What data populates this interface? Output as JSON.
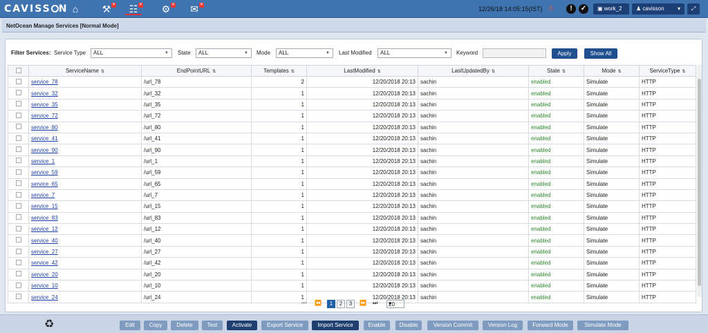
{
  "app": {
    "logo": "CAVISSON",
    "datetime": "12/26/18 14:05:15(IST)",
    "workspace": "work_2",
    "user": "cavisson"
  },
  "page_title": "NetOcean Manage Services [Normal Mode]",
  "filters": {
    "label": "Filter Services:",
    "service_type_label": "Service Type",
    "service_type_value": "ALL",
    "state_label": "State",
    "state_value": "ALL",
    "mode_label": "Mode",
    "mode_value": "ALL",
    "last_modified_label": "Last Modified",
    "last_modified_value": "ALL",
    "keyword_label": "Keyword",
    "keyword_value": "",
    "apply": "Apply",
    "show_all": "Show All"
  },
  "columns": [
    "ServiceName",
    "EndPointURL",
    "Templates",
    "LastModified",
    "LastUpdatedBy",
    "State",
    "Mode",
    "ServiceType"
  ],
  "rows": [
    [
      "service_78",
      "/url_78",
      "2",
      "12/20/2018 20:13",
      "sachin",
      "enabled",
      "Simulate",
      "HTTP"
    ],
    [
      "service_32",
      "/url_32",
      "1",
      "12/20/2018 20:13",
      "sachin",
      "enabled",
      "Simulate",
      "HTTP"
    ],
    [
      "service_35",
      "/url_35",
      "1",
      "12/20/2018 20:13",
      "sachin",
      "enabled",
      "Simulate",
      "HTTP"
    ],
    [
      "service_72",
      "/url_72",
      "1",
      "12/20/2018 20:13",
      "sachin",
      "enabled",
      "Simulate",
      "HTTP"
    ],
    [
      "service_80",
      "/url_80",
      "1",
      "12/20/2018 20:13",
      "sachin",
      "enabled",
      "Simulate",
      "HTTP"
    ],
    [
      "service_41",
      "/url_41",
      "1",
      "12/20/2018 20:13",
      "sachin",
      "enabled",
      "Simulate",
      "HTTP"
    ],
    [
      "service_90",
      "/url_90",
      "1",
      "12/20/2018 20:13",
      "sachin",
      "enabled",
      "Simulate",
      "HTTP"
    ],
    [
      "service_1",
      "/url_1",
      "1",
      "12/20/2018 20:13",
      "sachin",
      "enabled",
      "Simulate",
      "HTTP"
    ],
    [
      "service_59",
      "/url_59",
      "1",
      "12/20/2018 20:13",
      "sachin",
      "enabled",
      "Simulate",
      "HTTP"
    ],
    [
      "service_65",
      "/url_65",
      "1",
      "12/20/2018 20:13",
      "sachin",
      "enabled",
      "Simulate",
      "HTTP"
    ],
    [
      "service_7",
      "/url_7",
      "1",
      "12/20/2018 20:13",
      "sachin",
      "enabled",
      "Simulate",
      "HTTP"
    ],
    [
      "service_15",
      "/url_15",
      "1",
      "12/20/2018 20:13",
      "sachin",
      "enabled",
      "Simulate",
      "HTTP"
    ],
    [
      "service_83",
      "/url_83",
      "1",
      "12/20/2018 20:13",
      "sachin",
      "enabled",
      "Simulate",
      "HTTP"
    ],
    [
      "service_12",
      "/url_12",
      "1",
      "12/20/2018 20:13",
      "sachin",
      "enabled",
      "Simulate",
      "HTTP"
    ],
    [
      "service_40",
      "/url_40",
      "1",
      "12/20/2018 20:13",
      "sachin",
      "enabled",
      "Simulate",
      "HTTP"
    ],
    [
      "service_27",
      "/url_27",
      "1",
      "12/20/2018 20:13",
      "sachin",
      "enabled",
      "Simulate",
      "HTTP"
    ],
    [
      "service_42",
      "/url_42",
      "1",
      "12/20/2018 20:13",
      "sachin",
      "enabled",
      "Simulate",
      "HTTP"
    ],
    [
      "service_20",
      "/url_20",
      "1",
      "12/20/2018 20:13",
      "sachin",
      "enabled",
      "Simulate",
      "HTTP"
    ],
    [
      "service_10",
      "/url_10",
      "1",
      "12/20/2018 20:13",
      "sachin",
      "enabled",
      "Simulate",
      "HTTP"
    ],
    [
      "service_24",
      "/url_24",
      "1",
      "12/20/2018 20:13",
      "sachin",
      "enabled",
      "Simulate",
      "HTTP"
    ]
  ],
  "pager": {
    "pages": [
      "1",
      "2",
      "3"
    ],
    "current": "1",
    "page_size": "20"
  },
  "actions": [
    "Edit",
    "Copy",
    "Delete",
    "Test",
    "Activate",
    "Export Service",
    "Import Service",
    "Enable",
    "Disable",
    "Version Commit",
    "Version Log",
    "Forward Mode",
    "Simulate Mode"
  ]
}
